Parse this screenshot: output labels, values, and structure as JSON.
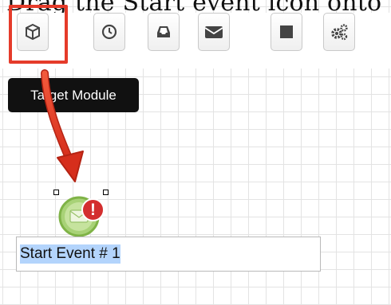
{
  "caption": "Drag the Start event icon onto",
  "toolbar": {
    "buttons": [
      {
        "name": "target-module-button",
        "icon": "cube-icon"
      },
      {
        "name": "clock-button",
        "icon": "clock-icon"
      },
      {
        "name": "inbox-button",
        "icon": "inbox-icon"
      },
      {
        "name": "envelope-button",
        "icon": "envelope-icon"
      },
      {
        "name": "square-button",
        "icon": "square-icon"
      },
      {
        "name": "gears-button",
        "icon": "gears-icon"
      }
    ]
  },
  "tooltip": {
    "text": "Target Module"
  },
  "node": {
    "type": "start-event",
    "warning": "!"
  },
  "label": {
    "text": "Start Event # 1"
  },
  "colors": {
    "highlight": "#e53b2a",
    "arrow": "#e53b2a",
    "selection": "#b3d4fc",
    "node": "#9ccc65",
    "warning": "#d32f2f"
  }
}
